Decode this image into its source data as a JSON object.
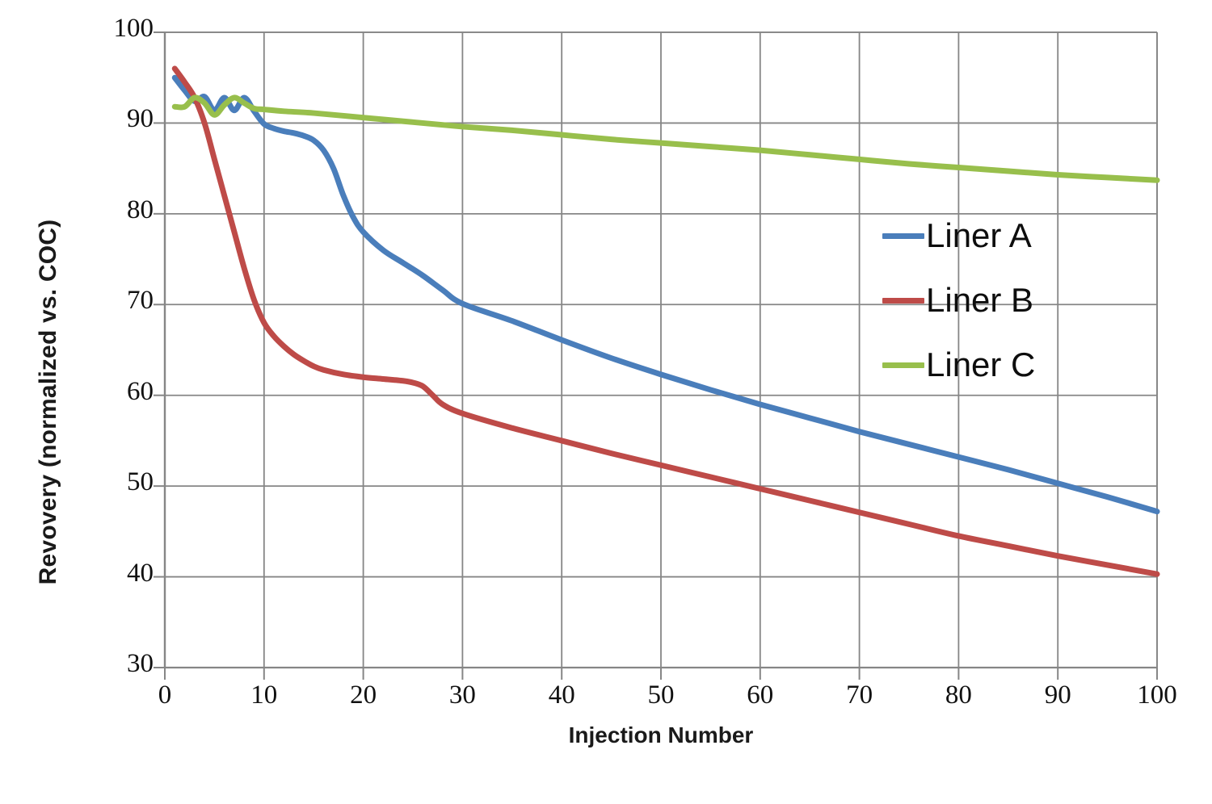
{
  "chart_data": {
    "type": "line",
    "title": "",
    "xlabel": "Injection Number",
    "ylabel": "Revovery (normalized vs. COC)",
    "xlim": [
      0,
      100
    ],
    "ylim": [
      30,
      100
    ],
    "xticks": [
      0,
      10,
      20,
      30,
      40,
      50,
      60,
      70,
      80,
      90,
      100
    ],
    "yticks": [
      30,
      40,
      50,
      60,
      70,
      80,
      90,
      100
    ],
    "grid": true,
    "legend_position": "inside-right",
    "series": [
      {
        "name": "Liner A",
        "color": "#4A7EBB",
        "x": [
          1,
          2,
          3,
          4,
          5,
          6,
          7,
          8,
          9,
          10,
          11,
          12,
          13,
          14,
          15,
          16,
          17,
          18,
          19,
          20,
          22,
          24,
          26,
          28,
          30,
          35,
          40,
          45,
          50,
          55,
          60,
          65,
          70,
          75,
          80,
          85,
          90,
          95,
          100
        ],
        "y": [
          95.0,
          93.6,
          92.4,
          92.9,
          91.4,
          92.8,
          91.4,
          92.8,
          91.3,
          89.9,
          89.4,
          89.1,
          88.9,
          88.6,
          88.1,
          87.0,
          85.0,
          82.0,
          79.6,
          78.0,
          76.0,
          74.6,
          73.2,
          71.6,
          70.1,
          68.2,
          66.1,
          64.1,
          62.3,
          60.6,
          59.0,
          57.5,
          56.0,
          54.6,
          53.2,
          51.8,
          50.3,
          48.8,
          47.2
        ]
      },
      {
        "name": "Liner B",
        "color": "#BE4B48",
        "x": [
          1,
          2,
          3,
          4,
          5,
          6,
          7,
          8,
          9,
          10,
          11,
          12,
          13,
          14,
          15,
          16,
          18,
          20,
          22,
          24,
          25,
          26,
          27,
          28,
          30,
          35,
          40,
          45,
          50,
          55,
          60,
          65,
          70,
          75,
          80,
          85,
          90,
          95,
          100
        ],
        "y": [
          96.0,
          94.5,
          92.8,
          90.0,
          86.0,
          82.0,
          78.0,
          74.0,
          70.5,
          68.0,
          66.5,
          65.4,
          64.5,
          63.8,
          63.2,
          62.8,
          62.3,
          62.0,
          61.8,
          61.6,
          61.4,
          61.0,
          60.0,
          59.0,
          58.0,
          56.4,
          55.0,
          53.6,
          52.3,
          51.0,
          49.7,
          48.4,
          47.1,
          45.8,
          44.5,
          43.4,
          42.3,
          41.3,
          40.3
        ]
      },
      {
        "name": "Liner C",
        "color": "#98BF4C",
        "x": [
          1,
          2,
          3,
          4,
          5,
          6,
          7,
          8,
          9,
          10,
          12,
          15,
          20,
          25,
          30,
          35,
          40,
          45,
          50,
          55,
          60,
          65,
          70,
          75,
          80,
          85,
          90,
          95,
          100
        ],
        "y": [
          91.8,
          91.8,
          92.8,
          92.2,
          90.9,
          92.0,
          92.8,
          92.2,
          91.6,
          91.5,
          91.3,
          91.1,
          90.6,
          90.1,
          89.6,
          89.2,
          88.7,
          88.2,
          87.8,
          87.4,
          87.0,
          86.5,
          86.0,
          85.5,
          85.1,
          84.7,
          84.3,
          84.0,
          83.7
        ]
      }
    ]
  },
  "legend": {
    "items": [
      {
        "label": "Liner A",
        "color": "#4A7EBB"
      },
      {
        "label": "Liner B",
        "color": "#BE4B48"
      },
      {
        "label": "Liner C",
        "color": "#98BF4C"
      }
    ]
  }
}
